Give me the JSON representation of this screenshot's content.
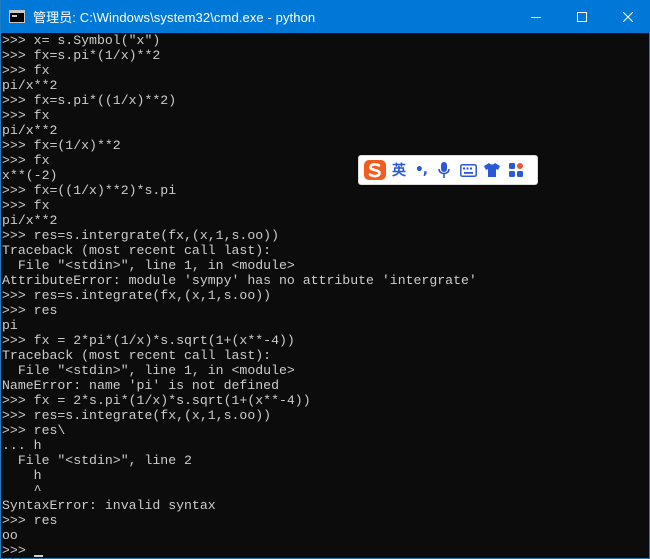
{
  "window": {
    "title": "管理员: C:\\Windows\\system32\\cmd.exe - python",
    "controls": {
      "minimize_icon": "minimize-icon",
      "maximize_icon": "maximize-icon",
      "close_icon": "close-icon"
    }
  },
  "console": {
    "lines": [
      ">>> x= s.Symbol(\"x\")",
      ">>> fx=s.pi*(1/x)**2",
      ">>> fx",
      "pi/x**2",
      ">>> fx=s.pi*((1/x)**2)",
      ">>> fx",
      "pi/x**2",
      ">>> fx=(1/x)**2",
      ">>> fx",
      "x**(-2)",
      ">>> fx=((1/x)**2)*s.pi",
      ">>> fx",
      "pi/x**2",
      ">>> res=s.intergrate(fx,(x,1,s.oo))",
      "Traceback (most recent call last):",
      "  File \"<stdin>\", line 1, in <module>",
      "AttributeError: module 'sympy' has no attribute 'intergrate'",
      ">>> res=s.integrate(fx,(x,1,s.oo))",
      ">>> res",
      "pi",
      ">>> fx = 2*pi*(1/x)*s.sqrt(1+(x**-4))",
      "Traceback (most recent call last):",
      "  File \"<stdin>\", line 1, in <module>",
      "NameError: name 'pi' is not defined",
      ">>> fx = 2*s.pi*(1/x)*s.sqrt(1+(x**-4))",
      ">>> res=s.integrate(fx,(x,1,s.oo))",
      ">>> res\\",
      "... h",
      "  File \"<stdin>\", line 2",
      "    h",
      "    ^",
      "SyntaxError: invalid syntax",
      ">>> res",
      "oo",
      ">>> "
    ]
  },
  "ime_toolbar": {
    "logo": "sogou-logo-icon",
    "lang": "英",
    "punct": "•,",
    "mic_icon": "microphone-icon",
    "keyboard_icon": "keyboard-icon",
    "skin_icon": "shirt-icon",
    "tools_icon": "grid-tools-icon",
    "accent": "#2a59d8",
    "logo_color": "#f25c1e"
  },
  "colors": {
    "titlebar": "#0078d7",
    "console_bg": "#0c0c0c",
    "console_text": "#cccccc"
  }
}
